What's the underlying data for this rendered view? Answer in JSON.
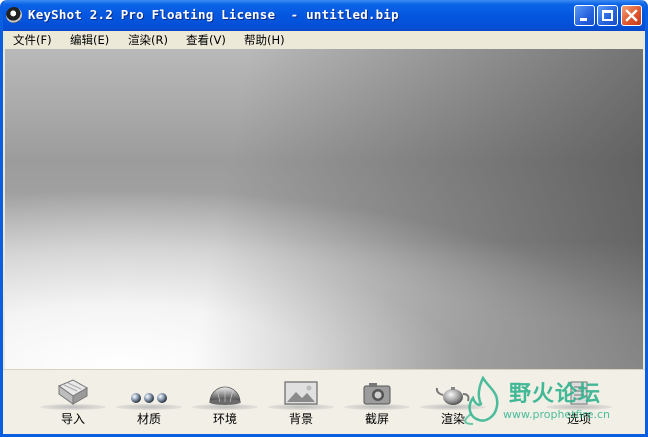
{
  "window": {
    "title": "KeyShot 2.2 Pro Floating License  - untitled.bip"
  },
  "menu": [
    {
      "label": "文件(F)"
    },
    {
      "label": "编辑(E)"
    },
    {
      "label": "渲染(R)"
    },
    {
      "label": "查看(V)"
    },
    {
      "label": "帮助(H)"
    }
  ],
  "toolbar": [
    {
      "label": "导入",
      "icon": "import-icon"
    },
    {
      "label": "材质",
      "icon": "materials-icon"
    },
    {
      "label": "环境",
      "icon": "environment-icon"
    },
    {
      "label": "背景",
      "icon": "background-icon"
    },
    {
      "label": "截屏",
      "icon": "screenshot-icon"
    },
    {
      "label": "渲染",
      "icon": "render-icon"
    },
    {
      "label": "选项",
      "icon": "options-icon"
    }
  ],
  "watermark": {
    "text": "野火论坛",
    "url": "www.prophetfire.cn"
  },
  "colors": {
    "titlebar": "#0456df",
    "window_frame": "#ece9d8",
    "watermark": "#2fb38e"
  }
}
